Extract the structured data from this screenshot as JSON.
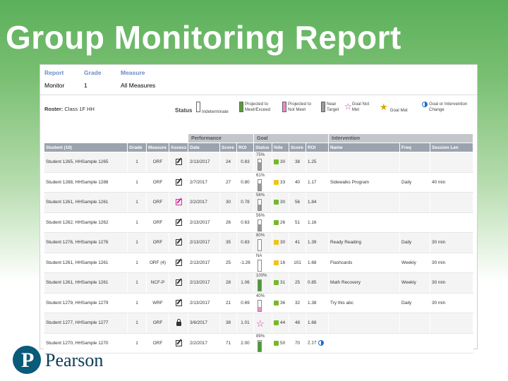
{
  "slide": {
    "title": "Group Monitoring Report"
  },
  "report": {
    "headers": {
      "report": "Report",
      "grade": "Grade",
      "measure": "Measure"
    },
    "values": {
      "report": "Monitor",
      "grade": "1",
      "measure": "All Measures"
    }
  },
  "roster": {
    "label": "Roster:",
    "value": "Class 1F HH"
  },
  "legend": {
    "status": "Status",
    "items": [
      {
        "label": "Indeterminate"
      },
      {
        "label": "Projected to Meet/Exceed"
      },
      {
        "label": "Projected to Not Meet"
      },
      {
        "label": "Near Target"
      },
      {
        "label": "Goal Not Met"
      },
      {
        "label": "Goal Met"
      },
      {
        "label": "Goal or Intervention Change"
      }
    ]
  },
  "table": {
    "groups": {
      "performance": "Performance",
      "goal": "Goal",
      "intervention": "Intervention"
    },
    "columns": [
      "Student (10)",
      "Grade",
      "Measure",
      "Assess",
      "Date",
      "Score",
      "ROI",
      "Status",
      "%ile",
      "Score",
      "ROI",
      "Name",
      "Freq",
      "Session Len"
    ],
    "rows": [
      {
        "student": "Student 1265, HHSample 1265",
        "grade": "1",
        "measure": "ORF",
        "assess": "pen-dark",
        "date": "2/13/2017",
        "score": "24",
        "roi": "0.83",
        "pct": "75%",
        "fill": 0.75,
        "fillColor": "gray",
        "pctileColor": "g",
        "pctile": "30",
        "gscore": "38",
        "groi": "1.25",
        "name": "",
        "freq": "",
        "sess": ""
      },
      {
        "student": "Student 1288, HHSample 1288",
        "grade": "1",
        "measure": "ORF",
        "assess": "pen-dark",
        "date": "2/7/2017",
        "score": "27",
        "roi": "0.80",
        "pct": "61%",
        "fill": 0.61,
        "fillColor": "gray",
        "pctileColor": "y",
        "pctile": "33",
        "gscore": "40",
        "groi": "1.17",
        "name": "Sidewalks Program",
        "freq": "Daily",
        "sess": "40 min"
      },
      {
        "student": "Student 1261, HHSample 1261",
        "grade": "1",
        "measure": "ORF",
        "assess": "pen-pink",
        "date": "2/2/2017",
        "score": "30",
        "roi": "0.78",
        "pct": "56%",
        "fill": 0.56,
        "fillColor": "gray",
        "pctileColor": "g",
        "pctile": "30",
        "gscore": "56",
        "groi": "1.84",
        "name": "",
        "freq": "",
        "sess": ""
      },
      {
        "student": "Student 1262, HHSample 1262",
        "grade": "1",
        "measure": "ORF",
        "assess": "pen-dark",
        "date": "2/13/2017",
        "score": "26",
        "roi": "0.63",
        "pct": "56%",
        "fill": 0.56,
        "fillColor": "gray",
        "pctileColor": "g",
        "pctile": "26",
        "gscore": "51",
        "groi": "1.16",
        "name": "",
        "freq": "",
        "sess": ""
      },
      {
        "student": "Student 1276, HHSample 1276",
        "grade": "1",
        "measure": "ORF",
        "assess": "pen-dark",
        "date": "2/13/2017",
        "score": "35",
        "roi": "0.83",
        "pct": "80%",
        "fill": 0.0,
        "fillColor": "gray",
        "pctileColor": "y",
        "pctile": "30",
        "gscore": "41",
        "groi": "1.39",
        "name": "Ready Reading",
        "freq": "Daily",
        "sess": "30 min"
      },
      {
        "student": "Student 1261, HHSample 1261",
        "grade": "1",
        "measure": "ORF (4)",
        "assess": "pen-dark",
        "date": "2/13/2017",
        "score": "25",
        "roi": "-1.26",
        "pct": "NA",
        "fill": 0.0,
        "fillColor": "gray",
        "pctileColor": "y",
        "pctile": "16",
        "gscore": "101",
        "groi": "1.68",
        "name": "Flashcards",
        "freq": "Weekly",
        "sess": "30 min"
      },
      {
        "student": "Student 1261, HHSample 1261",
        "grade": "1",
        "measure": "NCF-P",
        "assess": "pen-dark",
        "date": "2/13/2017",
        "score": "28",
        "roi": "1.06",
        "pct": "100%",
        "fill": 1.0,
        "fillColor": "green",
        "pctileColor": "g",
        "pctile": "31",
        "gscore": "25",
        "groi": "0.85",
        "name": "Math Recovery",
        "freq": "Weekly",
        "sess": "30 min"
      },
      {
        "student": "Student 1279, HHSample 1279",
        "grade": "1",
        "measure": "WRF",
        "assess": "pen-dark",
        "date": "2/13/2017",
        "score": "21",
        "roi": "0.69",
        "pct": "40%",
        "fill": 0.4,
        "fillColor": "pink",
        "pctileColor": "g",
        "pctile": "36",
        "gscore": "32",
        "groi": "1.38",
        "name": "Try this abc",
        "freq": "Daily",
        "sess": "30 min"
      },
      {
        "student": "Student 1277, HHSample 1277",
        "grade": "1",
        "measure": "ORF",
        "assess": "lock",
        "date": "3/6/2017",
        "score": "38",
        "roi": "1.01",
        "pct": "",
        "fill": 0.0,
        "fillColor": "gray",
        "pctileColor": "g",
        "pctile": "44",
        "gscore": "48",
        "groi": "1.68",
        "name": "",
        "freq": "",
        "sess": "",
        "star": true
      },
      {
        "student": "Student 1270, HHSample 1270",
        "grade": "1",
        "measure": "ORF",
        "assess": "pen-dark",
        "date": "2/2/2017",
        "score": "71",
        "roi": "2.00",
        "pct": "89%",
        "fill": 0.89,
        "fillColor": "green",
        "pctileColor": "g",
        "pctile": "50",
        "gscore": "70",
        "groi": "2.17",
        "name": "",
        "freq": "",
        "sess": "",
        "change": true
      }
    ]
  },
  "brand": {
    "name": "Pearson",
    "mark": "P"
  },
  "colors": {
    "accent": "#6a8cc6",
    "header": "#9aa3ae",
    "slideGreen": "#5bb05a"
  }
}
